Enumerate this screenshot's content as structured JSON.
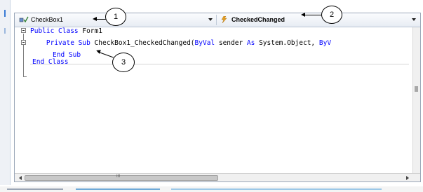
{
  "toolbar": {
    "class_dropdown": {
      "selected": "CheckBox1",
      "icon": "control-icon"
    },
    "event_dropdown": {
      "selected": "CheckedChanged",
      "icon": "lightning-icon"
    }
  },
  "code": {
    "line1": {
      "kw": "Public Class",
      "rest": " Form1"
    },
    "line2": {
      "indent": "    ",
      "kw1": "Private Sub",
      "mid": " CheckBox1_CheckedChanged(",
      "kw2": "ByVal",
      "mid2": " sender ",
      "kw3": "As",
      "mid3": " System.Object, ",
      "kw4": "ByV"
    },
    "line3": {
      "kw": "End Sub"
    },
    "line4": {
      "kw": "End Class"
    }
  },
  "scrollbar": {
    "grip": "III"
  },
  "callouts": [
    "1",
    "2",
    "3"
  ],
  "colors": {
    "keyword": "#0000ff",
    "text": "#000000",
    "frame": "#9aa7b8"
  }
}
